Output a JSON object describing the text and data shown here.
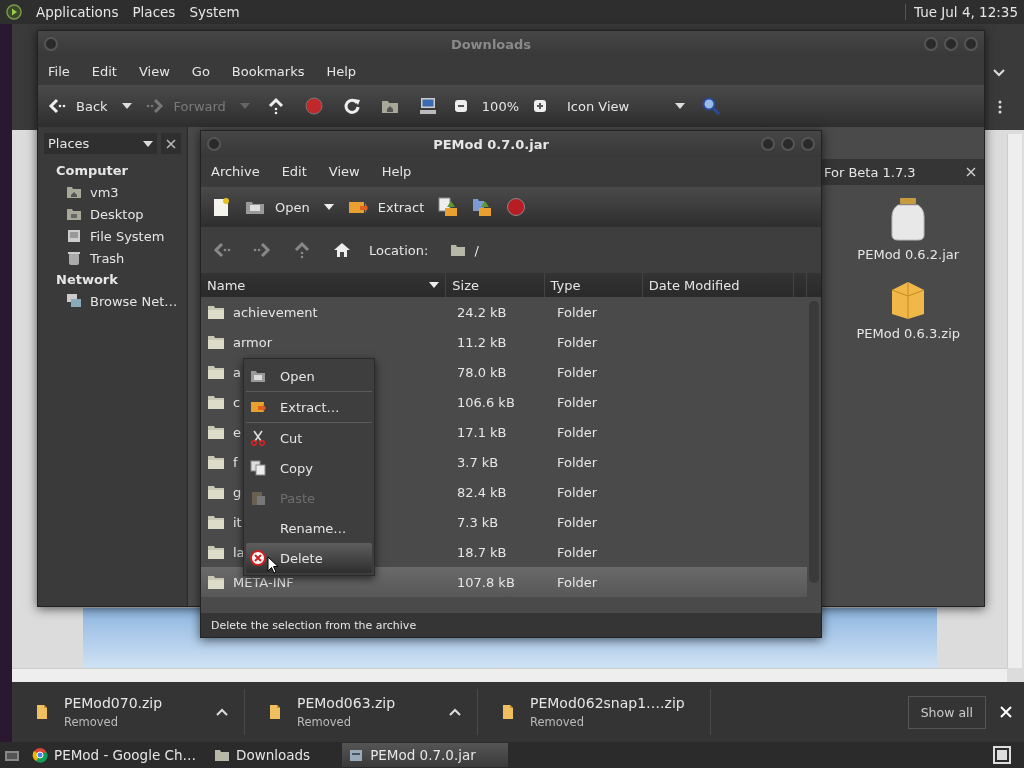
{
  "top_panel": {
    "menus": [
      "Applications",
      "Places",
      "System"
    ],
    "clock": "Tue Jul 4, 12:35"
  },
  "file_manager": {
    "title": "Downloads",
    "menu": [
      "File",
      "Edit",
      "View",
      "Go",
      "Bookmarks",
      "Help"
    ],
    "toolbar": {
      "back": "Back",
      "forward": "Forward",
      "forward_disabled": true,
      "zoom": "100%",
      "view": "Icon View"
    },
    "places": {
      "header": "Places",
      "sections": [
        {
          "title": "Computer",
          "items": [
            {
              "label": "vm3",
              "kind": "home"
            },
            {
              "label": "Desktop",
              "kind": "desktop"
            },
            {
              "label": "File System",
              "kind": "drive"
            },
            {
              "label": "Trash",
              "kind": "trash"
            }
          ]
        },
        {
          "title": "Network",
          "items": [
            {
              "label": "Browse Net…",
              "kind": "network"
            }
          ]
        }
      ]
    },
    "pane": {
      "tab": "For Beta 1.7.3",
      "files": [
        {
          "name": "PEMod 0.6.2.jar",
          "kind": "jar"
        },
        {
          "name": "PEMod 0.6.3.zip",
          "kind": "zip"
        }
      ]
    }
  },
  "archive": {
    "title": "PEMod 0.7.0.jar",
    "menu": [
      "Archive",
      "Edit",
      "View",
      "Help"
    ],
    "toolbar": {
      "open": "Open",
      "extract": "Extract"
    },
    "location_label": "Location:",
    "location": "/",
    "columns": [
      "Name",
      "Size",
      "Type",
      "Date Modified"
    ],
    "rows": [
      {
        "name": "achievement",
        "size": "24.2 kB",
        "type": "Folder",
        "selected": false
      },
      {
        "name": "armor",
        "size": "11.2 kB",
        "type": "Folder",
        "selected": false
      },
      {
        "name": "a",
        "size": "78.0 kB",
        "type": "Folder",
        "selected": false
      },
      {
        "name": "c",
        "size": "106.6 kB",
        "type": "Folder",
        "selected": false
      },
      {
        "name": "e",
        "size": "17.1 kB",
        "type": "Folder",
        "selected": false
      },
      {
        "name": "f",
        "size": "3.7 kB",
        "type": "Folder",
        "selected": false
      },
      {
        "name": "g",
        "size": "82.4 kB",
        "type": "Folder",
        "selected": false
      },
      {
        "name": "it",
        "size": "7.3 kB",
        "type": "Folder",
        "selected": false
      },
      {
        "name": "la",
        "size": "18.7 kB",
        "type": "Folder",
        "selected": false
      },
      {
        "name": "META-INF",
        "size": "107.8 kB",
        "type": "Folder",
        "selected": true
      }
    ],
    "status": "Delete the selection from the archive"
  },
  "context_menu": {
    "groups": [
      [
        {
          "label": "Open",
          "kind": "open",
          "disabled": false,
          "selected": false
        }
      ],
      [
        {
          "label": "Extract…",
          "kind": "extract",
          "disabled": false,
          "selected": false
        }
      ],
      [
        {
          "label": "Cut",
          "kind": "cut",
          "disabled": false,
          "selected": false
        },
        {
          "label": "Copy",
          "kind": "copy",
          "disabled": false,
          "selected": false
        },
        {
          "label": "Paste",
          "kind": "paste",
          "disabled": true,
          "selected": false
        },
        {
          "label": "Rename…",
          "kind": "none",
          "disabled": false,
          "selected": false
        },
        {
          "label": "Delete",
          "kind": "delete",
          "disabled": false,
          "selected": true
        }
      ]
    ]
  },
  "downloads_bar": {
    "items": [
      {
        "name": "PEMod070.zip",
        "status": "Removed"
      },
      {
        "name": "PEMod063.zip",
        "status": "Removed"
      },
      {
        "name": "PEMod062snap1….zip",
        "status": "Removed"
      }
    ],
    "show_all": "Show all"
  },
  "taskbar": {
    "items": [
      {
        "label": "PEMod - Google Ch…",
        "kind": "browser",
        "selected": false
      },
      {
        "label": "Downloads",
        "kind": "folder",
        "selected": false
      },
      {
        "label": "PEMod 0.7.0.jar",
        "kind": "archive",
        "selected": true
      }
    ]
  }
}
